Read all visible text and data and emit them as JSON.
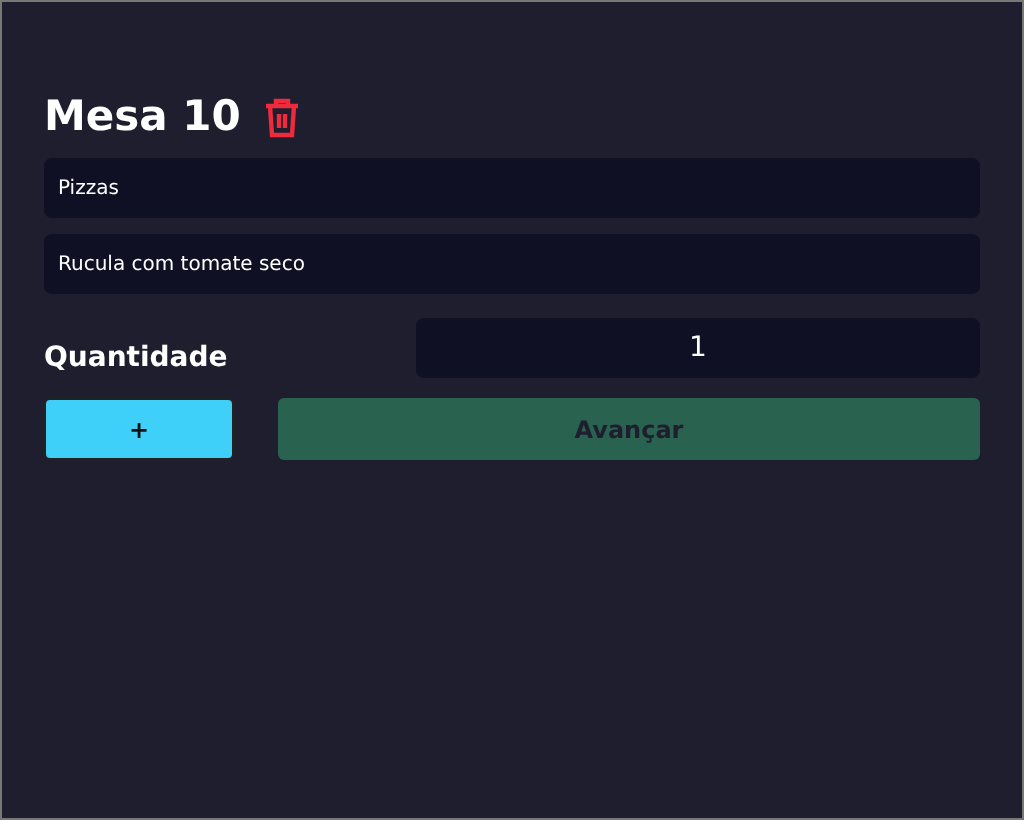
{
  "title": "Mesa 10",
  "fields": [
    {
      "value": "Pizzas"
    },
    {
      "value": "Rucula com tomate seco"
    }
  ],
  "quantity": {
    "label": "Quantidade",
    "value": "1"
  },
  "buttons": [
    {
      "kind": "add",
      "label": "+",
      "disabled": false
    },
    {
      "kind": "next",
      "label": "Avançar",
      "disabled": true
    }
  ]
}
